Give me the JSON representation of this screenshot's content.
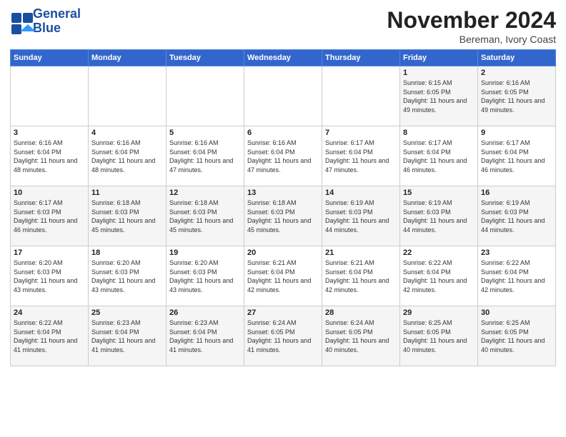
{
  "logo": {
    "line1": "General",
    "line2": "Blue"
  },
  "title": "November 2024",
  "subtitle": "Bereman, Ivory Coast",
  "days_of_week": [
    "Sunday",
    "Monday",
    "Tuesday",
    "Wednesday",
    "Thursday",
    "Friday",
    "Saturday"
  ],
  "weeks": [
    [
      {
        "day": "",
        "info": ""
      },
      {
        "day": "",
        "info": ""
      },
      {
        "day": "",
        "info": ""
      },
      {
        "day": "",
        "info": ""
      },
      {
        "day": "",
        "info": ""
      },
      {
        "day": "1",
        "info": "Sunrise: 6:15 AM\nSunset: 6:05 PM\nDaylight: 11 hours and 49 minutes."
      },
      {
        "day": "2",
        "info": "Sunrise: 6:16 AM\nSunset: 6:05 PM\nDaylight: 11 hours and 49 minutes."
      }
    ],
    [
      {
        "day": "3",
        "info": "Sunrise: 6:16 AM\nSunset: 6:04 PM\nDaylight: 11 hours and 48 minutes."
      },
      {
        "day": "4",
        "info": "Sunrise: 6:16 AM\nSunset: 6:04 PM\nDaylight: 11 hours and 48 minutes."
      },
      {
        "day": "5",
        "info": "Sunrise: 6:16 AM\nSunset: 6:04 PM\nDaylight: 11 hours and 47 minutes."
      },
      {
        "day": "6",
        "info": "Sunrise: 6:16 AM\nSunset: 6:04 PM\nDaylight: 11 hours and 47 minutes."
      },
      {
        "day": "7",
        "info": "Sunrise: 6:17 AM\nSunset: 6:04 PM\nDaylight: 11 hours and 47 minutes."
      },
      {
        "day": "8",
        "info": "Sunrise: 6:17 AM\nSunset: 6:04 PM\nDaylight: 11 hours and 46 minutes."
      },
      {
        "day": "9",
        "info": "Sunrise: 6:17 AM\nSunset: 6:04 PM\nDaylight: 11 hours and 46 minutes."
      }
    ],
    [
      {
        "day": "10",
        "info": "Sunrise: 6:17 AM\nSunset: 6:03 PM\nDaylight: 11 hours and 46 minutes."
      },
      {
        "day": "11",
        "info": "Sunrise: 6:18 AM\nSunset: 6:03 PM\nDaylight: 11 hours and 45 minutes."
      },
      {
        "day": "12",
        "info": "Sunrise: 6:18 AM\nSunset: 6:03 PM\nDaylight: 11 hours and 45 minutes."
      },
      {
        "day": "13",
        "info": "Sunrise: 6:18 AM\nSunset: 6:03 PM\nDaylight: 11 hours and 45 minutes."
      },
      {
        "day": "14",
        "info": "Sunrise: 6:19 AM\nSunset: 6:03 PM\nDaylight: 11 hours and 44 minutes."
      },
      {
        "day": "15",
        "info": "Sunrise: 6:19 AM\nSunset: 6:03 PM\nDaylight: 11 hours and 44 minutes."
      },
      {
        "day": "16",
        "info": "Sunrise: 6:19 AM\nSunset: 6:03 PM\nDaylight: 11 hours and 44 minutes."
      }
    ],
    [
      {
        "day": "17",
        "info": "Sunrise: 6:20 AM\nSunset: 6:03 PM\nDaylight: 11 hours and 43 minutes."
      },
      {
        "day": "18",
        "info": "Sunrise: 6:20 AM\nSunset: 6:03 PM\nDaylight: 11 hours and 43 minutes."
      },
      {
        "day": "19",
        "info": "Sunrise: 6:20 AM\nSunset: 6:03 PM\nDaylight: 11 hours and 43 minutes."
      },
      {
        "day": "20",
        "info": "Sunrise: 6:21 AM\nSunset: 6:04 PM\nDaylight: 11 hours and 42 minutes."
      },
      {
        "day": "21",
        "info": "Sunrise: 6:21 AM\nSunset: 6:04 PM\nDaylight: 11 hours and 42 minutes."
      },
      {
        "day": "22",
        "info": "Sunrise: 6:22 AM\nSunset: 6:04 PM\nDaylight: 11 hours and 42 minutes."
      },
      {
        "day": "23",
        "info": "Sunrise: 6:22 AM\nSunset: 6:04 PM\nDaylight: 11 hours and 42 minutes."
      }
    ],
    [
      {
        "day": "24",
        "info": "Sunrise: 6:22 AM\nSunset: 6:04 PM\nDaylight: 11 hours and 41 minutes."
      },
      {
        "day": "25",
        "info": "Sunrise: 6:23 AM\nSunset: 6:04 PM\nDaylight: 11 hours and 41 minutes."
      },
      {
        "day": "26",
        "info": "Sunrise: 6:23 AM\nSunset: 6:04 PM\nDaylight: 11 hours and 41 minutes."
      },
      {
        "day": "27",
        "info": "Sunrise: 6:24 AM\nSunset: 6:05 PM\nDaylight: 11 hours and 41 minutes."
      },
      {
        "day": "28",
        "info": "Sunrise: 6:24 AM\nSunset: 6:05 PM\nDaylight: 11 hours and 40 minutes."
      },
      {
        "day": "29",
        "info": "Sunrise: 6:25 AM\nSunset: 6:05 PM\nDaylight: 11 hours and 40 minutes."
      },
      {
        "day": "30",
        "info": "Sunrise: 6:25 AM\nSunset: 6:05 PM\nDaylight: 11 hours and 40 minutes."
      }
    ]
  ]
}
